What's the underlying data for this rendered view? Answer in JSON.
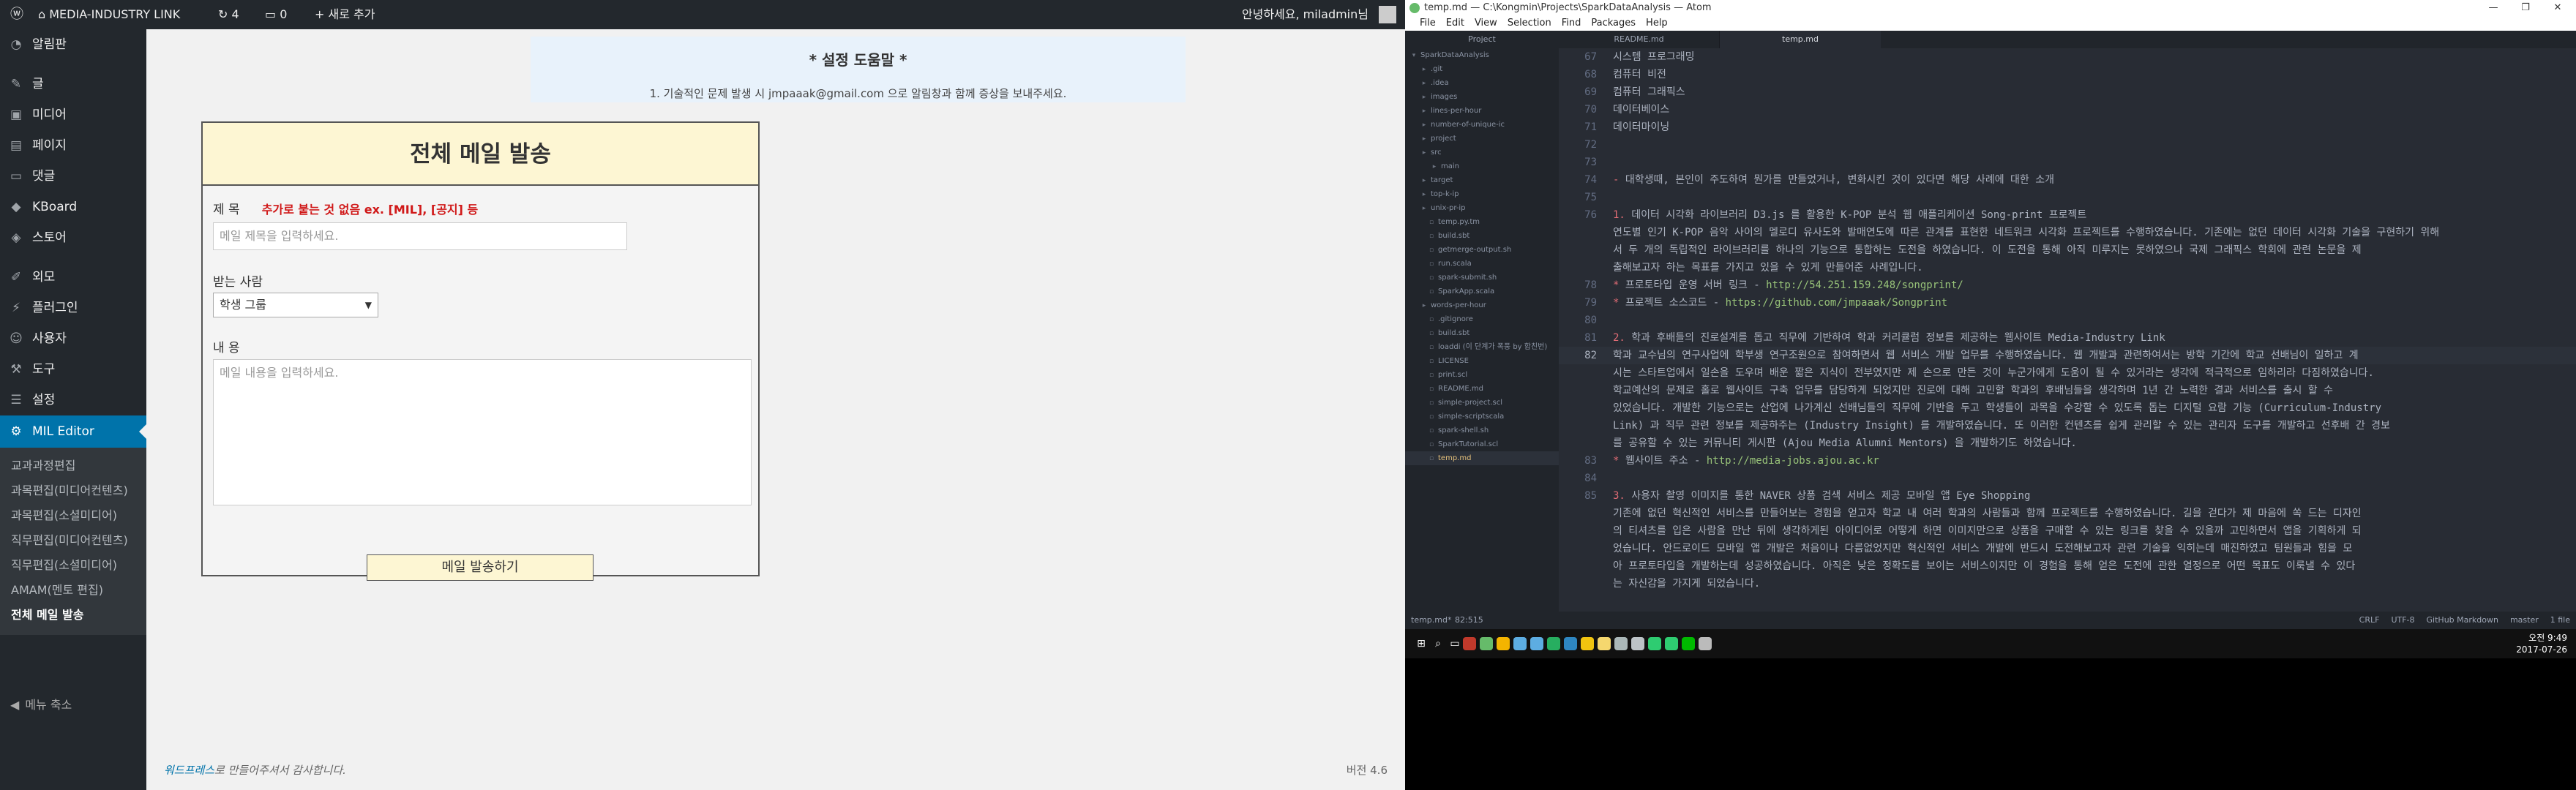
{
  "wp": {
    "adminbar": {
      "site_name": "MEDIA-INDUSTRY LINK",
      "updates_count": "4",
      "comments_count": "0",
      "new_label": "새로 추가",
      "greeting": "안녕하세요, miladmin님"
    },
    "menu": {
      "items": [
        {
          "label": "알림판",
          "icon": "dashboard-icon"
        },
        {
          "label": "글",
          "icon": "pin-icon"
        },
        {
          "label": "미디어",
          "icon": "media-icon"
        },
        {
          "label": "페이지",
          "icon": "page-icon"
        },
        {
          "label": "댓글",
          "icon": "comment-icon"
        },
        {
          "label": "KBoard",
          "icon": "kboard-icon"
        },
        {
          "label": "스토어",
          "icon": "store-icon"
        },
        {
          "label": "외모",
          "icon": "brush-icon"
        },
        {
          "label": "플러그인",
          "icon": "plugin-icon"
        },
        {
          "label": "사용자",
          "icon": "user-icon"
        },
        {
          "label": "도구",
          "icon": "wrench-icon"
        },
        {
          "label": "설정",
          "icon": "settings-icon"
        },
        {
          "label": "MIL Editor",
          "icon": "gear-icon"
        }
      ],
      "submenu": [
        "교과과정편집",
        "과목편집(미디어컨텐츠)",
        "과목편집(소셜미디어)",
        "직무편집(미디어컨텐츠)",
        "직무편집(소셜미디어)",
        "AMAM(멘토 편집)",
        "전체 메일 발송"
      ],
      "collapse_label": "메뉴 축소"
    },
    "help": {
      "title": "* 설정 도움말 *",
      "text": "1. 기술적인 문제 발생 시 jmpaaak@gmail.com 으로 알림창과 함께 증상을 보내주세요."
    },
    "mail": {
      "header": "전체 메일 발송",
      "subject_label": "제 목",
      "subject_note": "추가로 붙는 것 없음 ex. [MIL], [공지] 등",
      "subject_placeholder": "메일 제목을 입력하세요.",
      "recipient_label": "받는 사람",
      "recipient_value": "학생 그룹",
      "body_label": "내 용",
      "body_placeholder": "메일 내용을 입력하세요.",
      "send_label": "메일 발송하기"
    },
    "footer": {
      "thanks_link": "워드프레스",
      "thanks_rest": "로 만들어주셔서 감사합니다.",
      "version": "버전 4.6"
    }
  },
  "atom": {
    "title": "temp.md — C:\\Kongmin\\Projects\\SparkDataAnalysis — Atom",
    "menu": [
      "File",
      "Edit",
      "View",
      "Selection",
      "Find",
      "Packages",
      "Help"
    ],
    "tabs": [
      "Project",
      "README.md",
      "temp.md"
    ],
    "tree": [
      {
        "name": "SparkDataAnalysis",
        "kind": "root"
      },
      {
        "name": ".git",
        "kind": "folder"
      },
      {
        "name": ".idea",
        "kind": "folder"
      },
      {
        "name": "images",
        "kind": "folder"
      },
      {
        "name": "lines-per-hour",
        "kind": "folder"
      },
      {
        "name": "number-of-unique-ic",
        "kind": "folder"
      },
      {
        "name": "project",
        "kind": "folder"
      },
      {
        "name": "src",
        "kind": "folder"
      },
      {
        "name": "main",
        "kind": "subfolder"
      },
      {
        "name": "target",
        "kind": "folder"
      },
      {
        "name": "top-k-ip",
        "kind": "folder"
      },
      {
        "name": "unix-pr-ip",
        "kind": "folder"
      },
      {
        "name": "temp.py.tm",
        "kind": "file"
      },
      {
        "name": "build.sbt",
        "kind": "file"
      },
      {
        "name": "getmerge-output.sh",
        "kind": "file"
      },
      {
        "name": "run.scala",
        "kind": "file"
      },
      {
        "name": "spark-submit.sh",
        "kind": "file"
      },
      {
        "name": "SparkApp.scala",
        "kind": "file"
      },
      {
        "name": "words-per-hour",
        "kind": "folder"
      },
      {
        "name": ".gitignore",
        "kind": "file"
      },
      {
        "name": "build.sbt",
        "kind": "file"
      },
      {
        "name": "loaddi (이 단계가 폭풍 by 합친번)",
        "kind": "file"
      },
      {
        "name": "LICENSE",
        "kind": "file"
      },
      {
        "name": "print.scl",
        "kind": "file"
      },
      {
        "name": "README.md",
        "kind": "file"
      },
      {
        "name": "simple-project.scl",
        "kind": "file"
      },
      {
        "name": "simple-scriptscala",
        "kind": "file"
      },
      {
        "name": "spark-shell.sh",
        "kind": "file"
      },
      {
        "name": "SparkTutorial.scl",
        "kind": "file"
      },
      {
        "name": "temp.md",
        "kind": "active"
      }
    ],
    "lines": [
      {
        "n": "67",
        "parts": [
          {
            "t": "시스템 프로그래밍"
          }
        ]
      },
      {
        "n": "68",
        "parts": [
          {
            "t": "컴퓨터 비전"
          }
        ]
      },
      {
        "n": "69",
        "parts": [
          {
            "t": "컴퓨터 그래픽스"
          }
        ]
      },
      {
        "n": "70",
        "parts": [
          {
            "t": "데이터베이스"
          }
        ]
      },
      {
        "n": "71",
        "parts": [
          {
            "t": "데이터마이닝"
          }
        ]
      },
      {
        "n": "72",
        "parts": [
          {
            "t": ""
          }
        ]
      },
      {
        "n": "73",
        "parts": [
          {
            "t": ""
          }
        ]
      },
      {
        "n": "74",
        "parts": [
          {
            "t": "- ",
            "c": "cr"
          },
          {
            "t": "대학생때, 본인이 주도하여 뭔가를 만들었거나, 변화시킨 것이 있다면 해당 사례에 대한 소개"
          }
        ]
      },
      {
        "n": "75",
        "parts": [
          {
            "t": ""
          }
        ]
      },
      {
        "n": "76",
        "parts": [
          {
            "t": "1. ",
            "c": "cr"
          },
          {
            "t": "데이터 시각화 라이브러리 D3.js 를 활용한 K-POP 분석 웹 애플리케이션 Song-print 프로젝트"
          }
        ]
      },
      {
        "n": "",
        "parts": [
          {
            "t": "   연도별 인기 K-POP 음악 사이의 멜로디 유사도와 발매연도에 따른 관계를 표현한 네트워크 시각화 프로젝트를 수행하였습니다. 기존에는 없던 데이터 시각화 기술을 구현하기 위해"
          }
        ]
      },
      {
        "n": "",
        "parts": [
          {
            "t": "   서 두 개의 독립적인 라이브러리를 하나의 기능으로 통합하는 도전을 하였습니다. 이 도전을 통해 아직 미루지는 못하였으나 국제 그래픽스 학회에 관련 논문을 제"
          }
        ]
      },
      {
        "n": "",
        "parts": [
          {
            "t": "   출해보고자 하는 목표를 가지고 있을 수 있게 만들어준 사례입니다."
          }
        ]
      },
      {
        "n": "78",
        "parts": [
          {
            "t": "   * ",
            "c": "cr"
          },
          {
            "t": "프로토타입 운영 서버 링크 - "
          },
          {
            "t": "http://54.251.159.248/songprint/",
            "c": "cy"
          }
        ]
      },
      {
        "n": "79",
        "parts": [
          {
            "t": "   * ",
            "c": "cr"
          },
          {
            "t": "프로젝트 소스코드 - "
          },
          {
            "t": "https://github.com/jmpaaak/Songprint",
            "c": "cy"
          }
        ]
      },
      {
        "n": "80",
        "parts": [
          {
            "t": ""
          }
        ]
      },
      {
        "n": "81",
        "parts": [
          {
            "t": "2. ",
            "c": "cr"
          },
          {
            "t": "학과 후배들의 진로설계를 돕고 직무에 기반하여 학과 커리큘럼 정보를 제공하는 웹사이트 Media-Industry Link"
          }
        ]
      },
      {
        "n": "82",
        "parts": [
          {
            "t": "   학과 교수님의 연구사업에 학부생 연구조원으로 참여하면서 웹 서비스 개발 업무를 수행하였습니다. 웹 개발과 관련하여서는 방학 기간에 학교 선배님이 일하고 계"
          }
        ]
      },
      {
        "n": "",
        "parts": [
          {
            "t": "   시는 스타트업에서 일손을 도우며 배운 짧은 지식이 전부였지만 제 손으로 만든 것이 누군가에게 도움이 될 수 있거라는 생각에 적극적으로 임하리라 다짐하였습니다."
          }
        ]
      },
      {
        "n": "",
        "parts": [
          {
            "t": "   학교예산의 문제로 홀로 웹사이트 구축 업무를 담당하게 되었지만 진로에 대해 고민할 학과의 후배님들을 생각하며 1년 간 노력한 결과 서비스를 출시 할 수"
          }
        ]
      },
      {
        "n": "",
        "parts": [
          {
            "t": "   있었습니다. 개발한 기능으로는 산업에 나가계신 선배님들의 직무에 기반을 두고 학생들이 과목을 수강할 수 있도록 돕는 디지털 요람 기능 (Curriculum-Industry"
          }
        ]
      },
      {
        "n": "",
        "parts": [
          {
            "t": "   Link) 과 직무 관련 정보를 제공하주는 (Industry Insight) 를 개발하였습니다. 또 이러한 컨텐츠를 쉽게 관리할 수 있는 관리자 도구를 개발하고 선후배 간 경보"
          }
        ]
      },
      {
        "n": "",
        "parts": [
          {
            "t": "   를 공유할 수 있는 커뮤니티 게시판 (Ajou Media Alumni Mentors) 을 개발하기도 하였습니다."
          }
        ]
      },
      {
        "n": "83",
        "parts": [
          {
            "t": "   * ",
            "c": "cr"
          },
          {
            "t": "웹사이트 주소 - "
          },
          {
            "t": "http://media-jobs.ajou.ac.kr",
            "c": "cy"
          }
        ]
      },
      {
        "n": "84",
        "parts": [
          {
            "t": ""
          }
        ]
      },
      {
        "n": "85",
        "parts": [
          {
            "t": "3. ",
            "c": "cr"
          },
          {
            "t": "사용자 촬영 이미지를 통한 NAVER 상품 검색 서비스 제공 모바일 앱 Eye Shopping"
          }
        ]
      },
      {
        "n": "",
        "parts": [
          {
            "t": "   기존에 없던 혁신적인 서비스를 만들어보는 경험을 얻고자 학교 내 여러 학과의 사람들과 함께 프로젝트를 수행하였습니다. 길을 걷다가 제 마음에 쏙 드는 디자인"
          }
        ]
      },
      {
        "n": "",
        "parts": [
          {
            "t": "   의 티셔츠를 입은 사람을 만난 뒤에 생각하게된 아이디어로 어떻게 하면 이미지만으로 상품을 구매할 수 있는 링크를 찾을 수 있을까 고민하면서 앱을 기획하게 되"
          }
        ]
      },
      {
        "n": "",
        "parts": [
          {
            "t": "   었습니다. 안드로이드 모바일 앱 개발은 처음이나 다름없었지만 혁신적인 서비스 개발에 반드시 도전해보고자 관련 기술을 익히는데 매진하였고 팀원들과 힘을 모"
          }
        ]
      },
      {
        "n": "",
        "parts": [
          {
            "t": "   아 프로토타입을 개발하는데 성공하였습니다. 아직은 낮은 정확도를 보이는 서비스이지만 이 경험을 통해 얻은 도전에 관한 열정으로 어떤 목표도 이룩낼 수 있다"
          }
        ]
      },
      {
        "n": "",
        "parts": [
          {
            "t": "   는 자신감을 가지게 되었습니다."
          }
        ]
      }
    ],
    "status": {
      "file": "temp.md*",
      "pos": "82:515",
      "right": [
        "CRLF",
        "UTF-8",
        "GitHub Markdown",
        "master",
        "1 file"
      ]
    },
    "taskbar": {
      "time": "오전 9:49",
      "date": "2017-07-26",
      "apps": [
        {
          "icon": "windows-icon",
          "color": "#ffffff"
        },
        {
          "icon": "search-icon",
          "color": "#ffffff"
        },
        {
          "icon": "taskview-icon",
          "color": "#ffffff"
        },
        {
          "icon": "app-red-icon",
          "color": "#c0392b"
        },
        {
          "icon": "atom-icon",
          "color": "#66bb6a"
        },
        {
          "icon": "chrome-icon",
          "color": "#f4b400"
        },
        {
          "icon": "globe-icon",
          "color": "#5dade2"
        },
        {
          "icon": "network-icon",
          "color": "#5dade2"
        },
        {
          "icon": "app-green-icon",
          "color": "#27ae60"
        },
        {
          "icon": "terminal-icon",
          "color": "#2e86c1"
        },
        {
          "icon": "folder-icon",
          "color": "#f1c40f"
        },
        {
          "icon": "notes-icon",
          "color": "#f5d76e"
        },
        {
          "icon": "cloud-icon",
          "color": "#aab7b8"
        },
        {
          "icon": "doc-icon",
          "color": "#bdc3c7"
        },
        {
          "icon": "kakao-icon",
          "color": "#2ecc71"
        },
        {
          "icon": "chat-icon",
          "color": "#2ecc71"
        },
        {
          "icon": "line-icon",
          "color": "#00b900"
        },
        {
          "icon": "settings-icon",
          "color": "#bbbbbb"
        }
      ]
    }
  }
}
